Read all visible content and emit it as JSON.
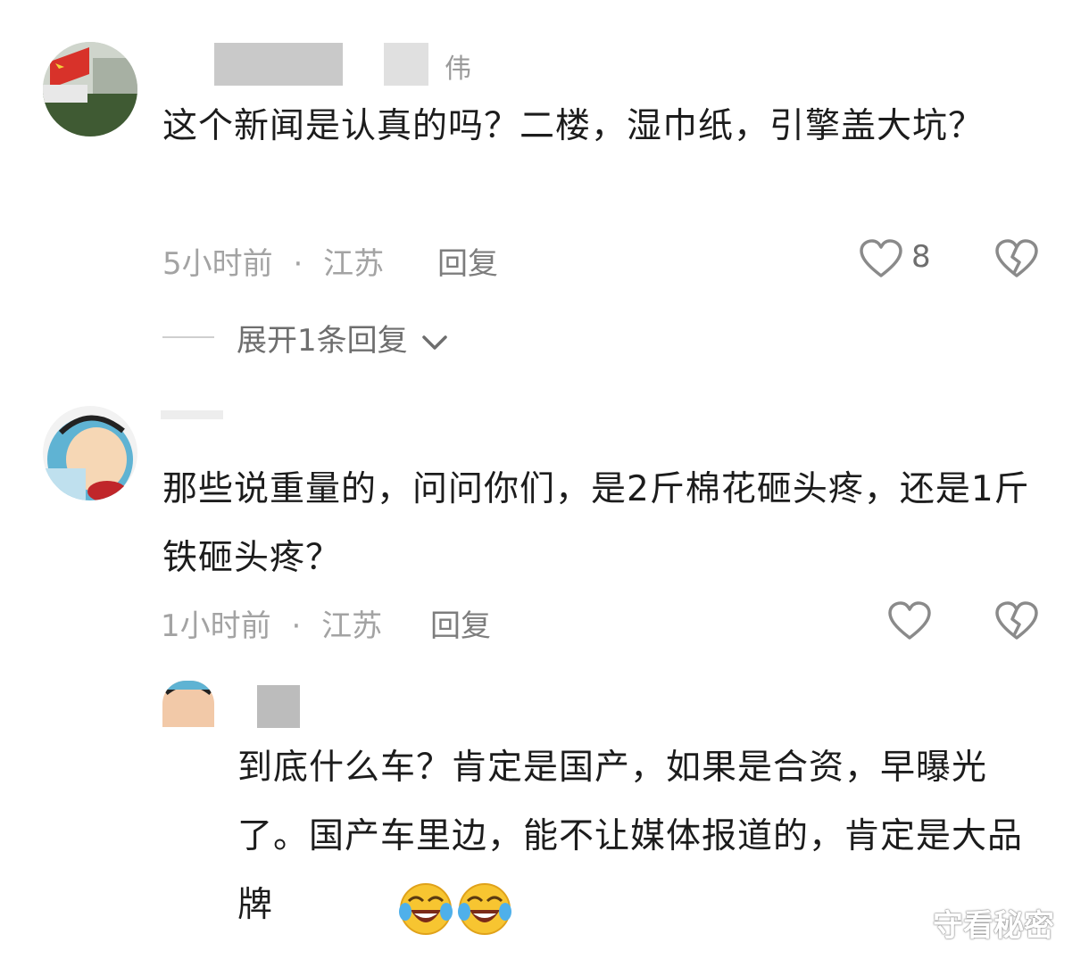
{
  "comments": [
    {
      "username_suffix": "伟",
      "text": "这个新闻是认真的吗？二楼，湿巾纸，引擎盖大坑？",
      "time": "5小时前",
      "location": "江苏",
      "reply_label": "回复",
      "like_count": "8",
      "expand_label": "展开1条回复"
    },
    {
      "text": "那些说重量的，问问你们，是2斤棉花砸头疼，还是1斤铁砸头疼？",
      "time": "1小时前",
      "location": "江苏",
      "reply_label": "回复",
      "replies": [
        {
          "text": "到底什么车？肯定是国产，如果是合资，早曝光了。国产车里边，能不让媒体报道的，肯定是大品牌"
        }
      ]
    }
  ],
  "meta_separator": "·",
  "watermark": "守看秘密",
  "colors": {
    "background": "#ffffff",
    "text": "#1c1c1c",
    "meta": "#a3a3a3",
    "icon": "#8a8a8a"
  },
  "icons": [
    "heart-outline-icon",
    "broken-heart-icon",
    "chevron-down-icon",
    "laughing-crying-emoji"
  ]
}
